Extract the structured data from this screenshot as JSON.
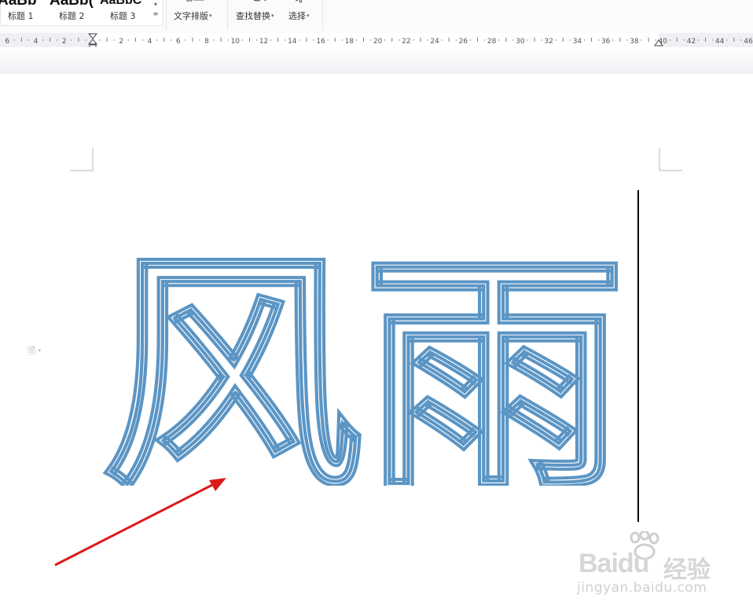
{
  "toolbar": {
    "styles": [
      {
        "preview": "AaBb",
        "name": "标题 1"
      },
      {
        "preview": "AaBb(",
        "name": "标题 2"
      },
      {
        "preview": "AaBbC",
        "name": "标题 3"
      }
    ],
    "text_layout_label": "文字排版",
    "find_replace_label": "查找替换",
    "select_label": "选择"
  },
  "ruler": {
    "labels": [
      "6",
      "4",
      "2",
      "2",
      "4",
      "6",
      "8",
      "10",
      "12",
      "14",
      "16",
      "18",
      "20",
      "22",
      "24",
      "26",
      "28",
      "30",
      "32",
      "34",
      "36",
      "38",
      "40",
      "42",
      "44",
      "46"
    ]
  },
  "document": {
    "outline_text": "风雨"
  },
  "colors": {
    "outline": "#5b95c4",
    "arrow": "#dd1a1a",
    "cursor_line": "#000000"
  },
  "watermark": {
    "brand": "Baidu",
    "brand_cn": "经验",
    "url": "jingyan.baidu.com"
  }
}
